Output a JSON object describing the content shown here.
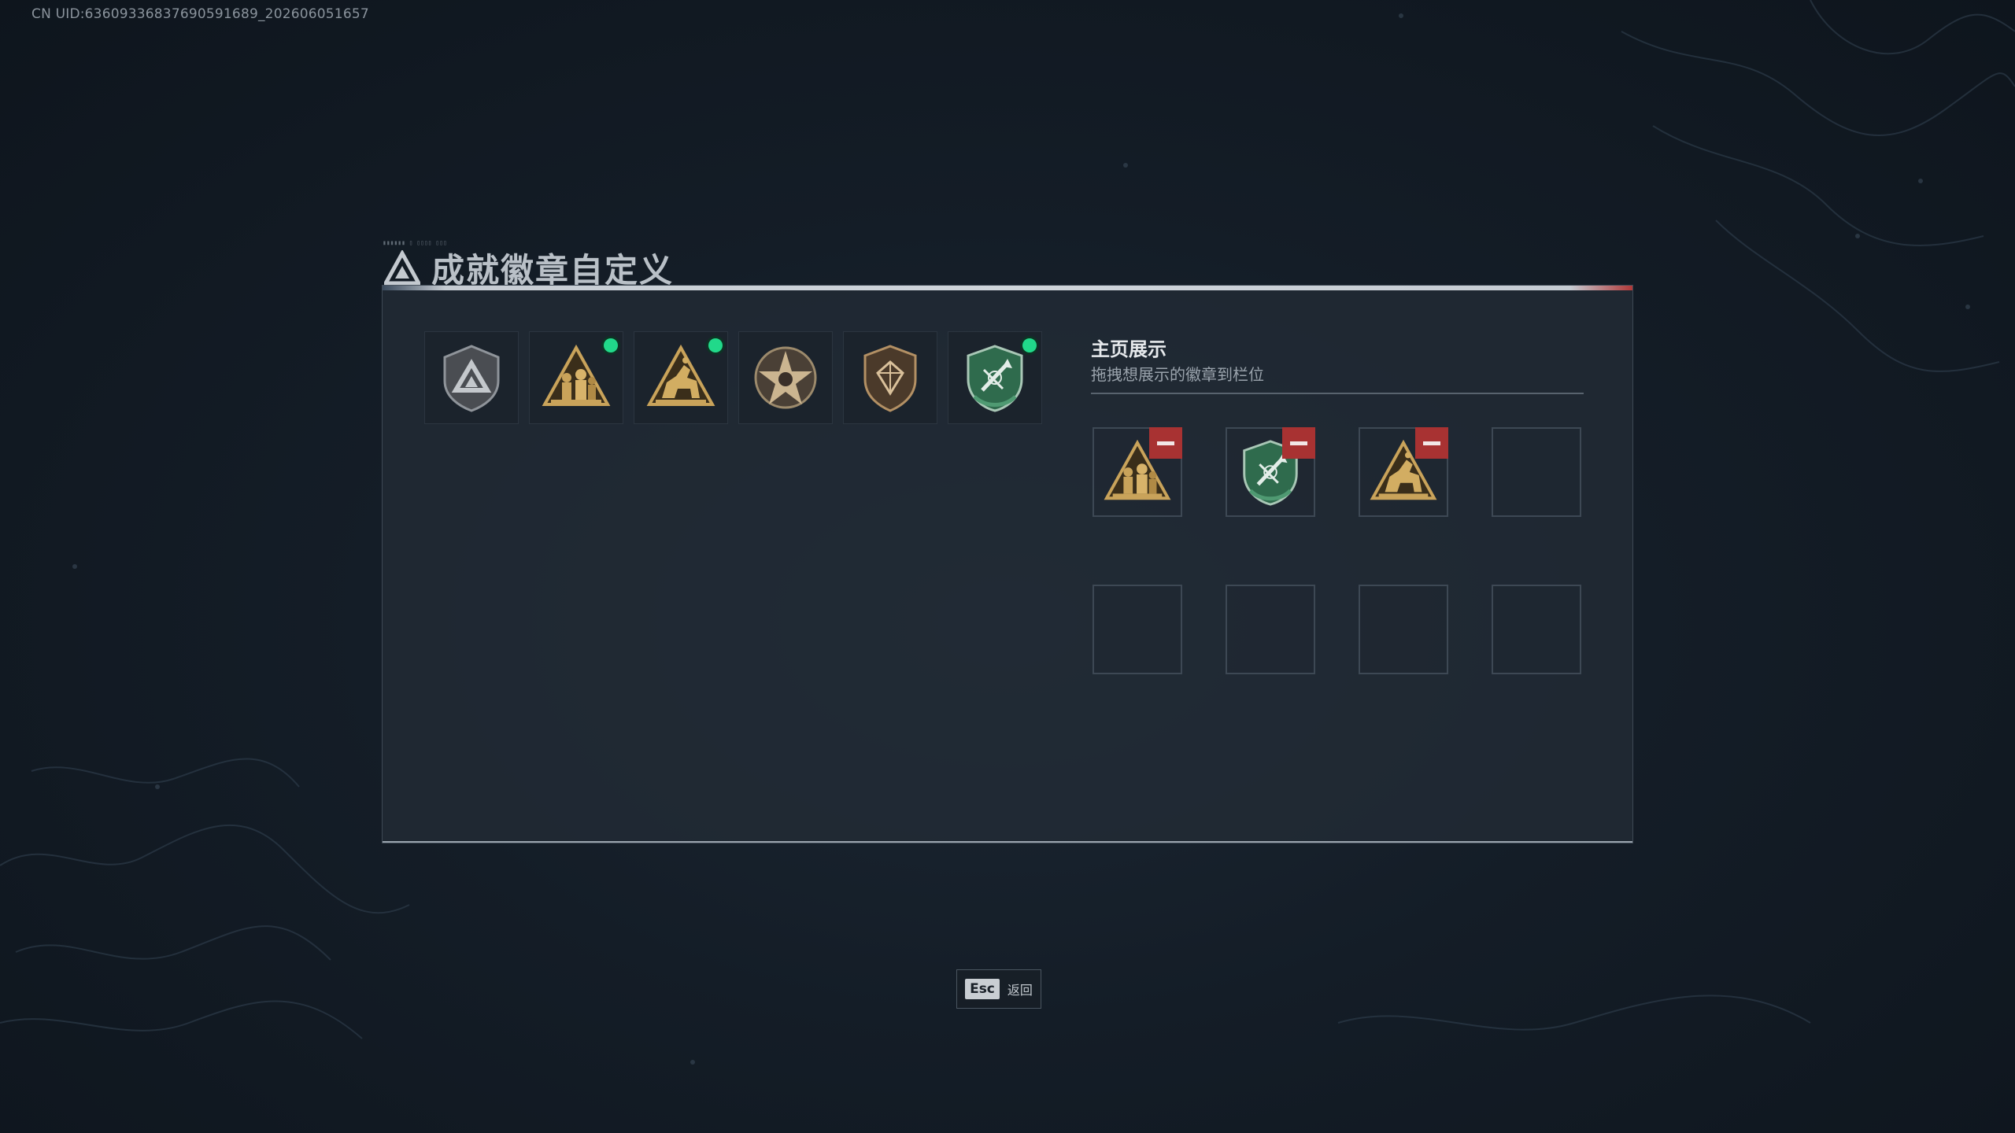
{
  "uid_text": "CN UID:63609336837690591689_202606051657",
  "dialog": {
    "title": "成就徽章自定义",
    "inventory": [
      {
        "icon": "grey-shield-triangle-badge-icon",
        "is_new": false
      },
      {
        "icon": "gold-triangle-soldiers-badge-icon",
        "is_new": true
      },
      {
        "icon": "gold-triangle-horse-badge-icon",
        "is_new": true
      },
      {
        "icon": "bronze-star-skull-badge-icon",
        "is_new": false
      },
      {
        "icon": "bronze-shield-gem-badge-icon",
        "is_new": false
      },
      {
        "icon": "green-shield-arrows-badge-icon",
        "is_new": true
      }
    ],
    "showcase": {
      "title": "主页展示",
      "subtitle": "拖拽想展示的徽章到栏位",
      "slots": [
        {
          "icon": "gold-triangle-soldiers-badge-icon",
          "filled": true
        },
        {
          "icon": "green-shield-arrows-badge-icon",
          "filled": true
        },
        {
          "icon": "gold-triangle-horse-badge-icon",
          "filled": true
        },
        {
          "filled": false
        },
        {
          "filled": false
        },
        {
          "filled": false
        },
        {
          "filled": false
        },
        {
          "filled": false
        }
      ]
    }
  },
  "footer": {
    "esc_key": "Esc",
    "esc_label": "返回"
  },
  "colors": {
    "new_dot": "#21d98a",
    "remove": "#a83232",
    "gold": "#c9a35a",
    "green": "#2f7a57"
  }
}
